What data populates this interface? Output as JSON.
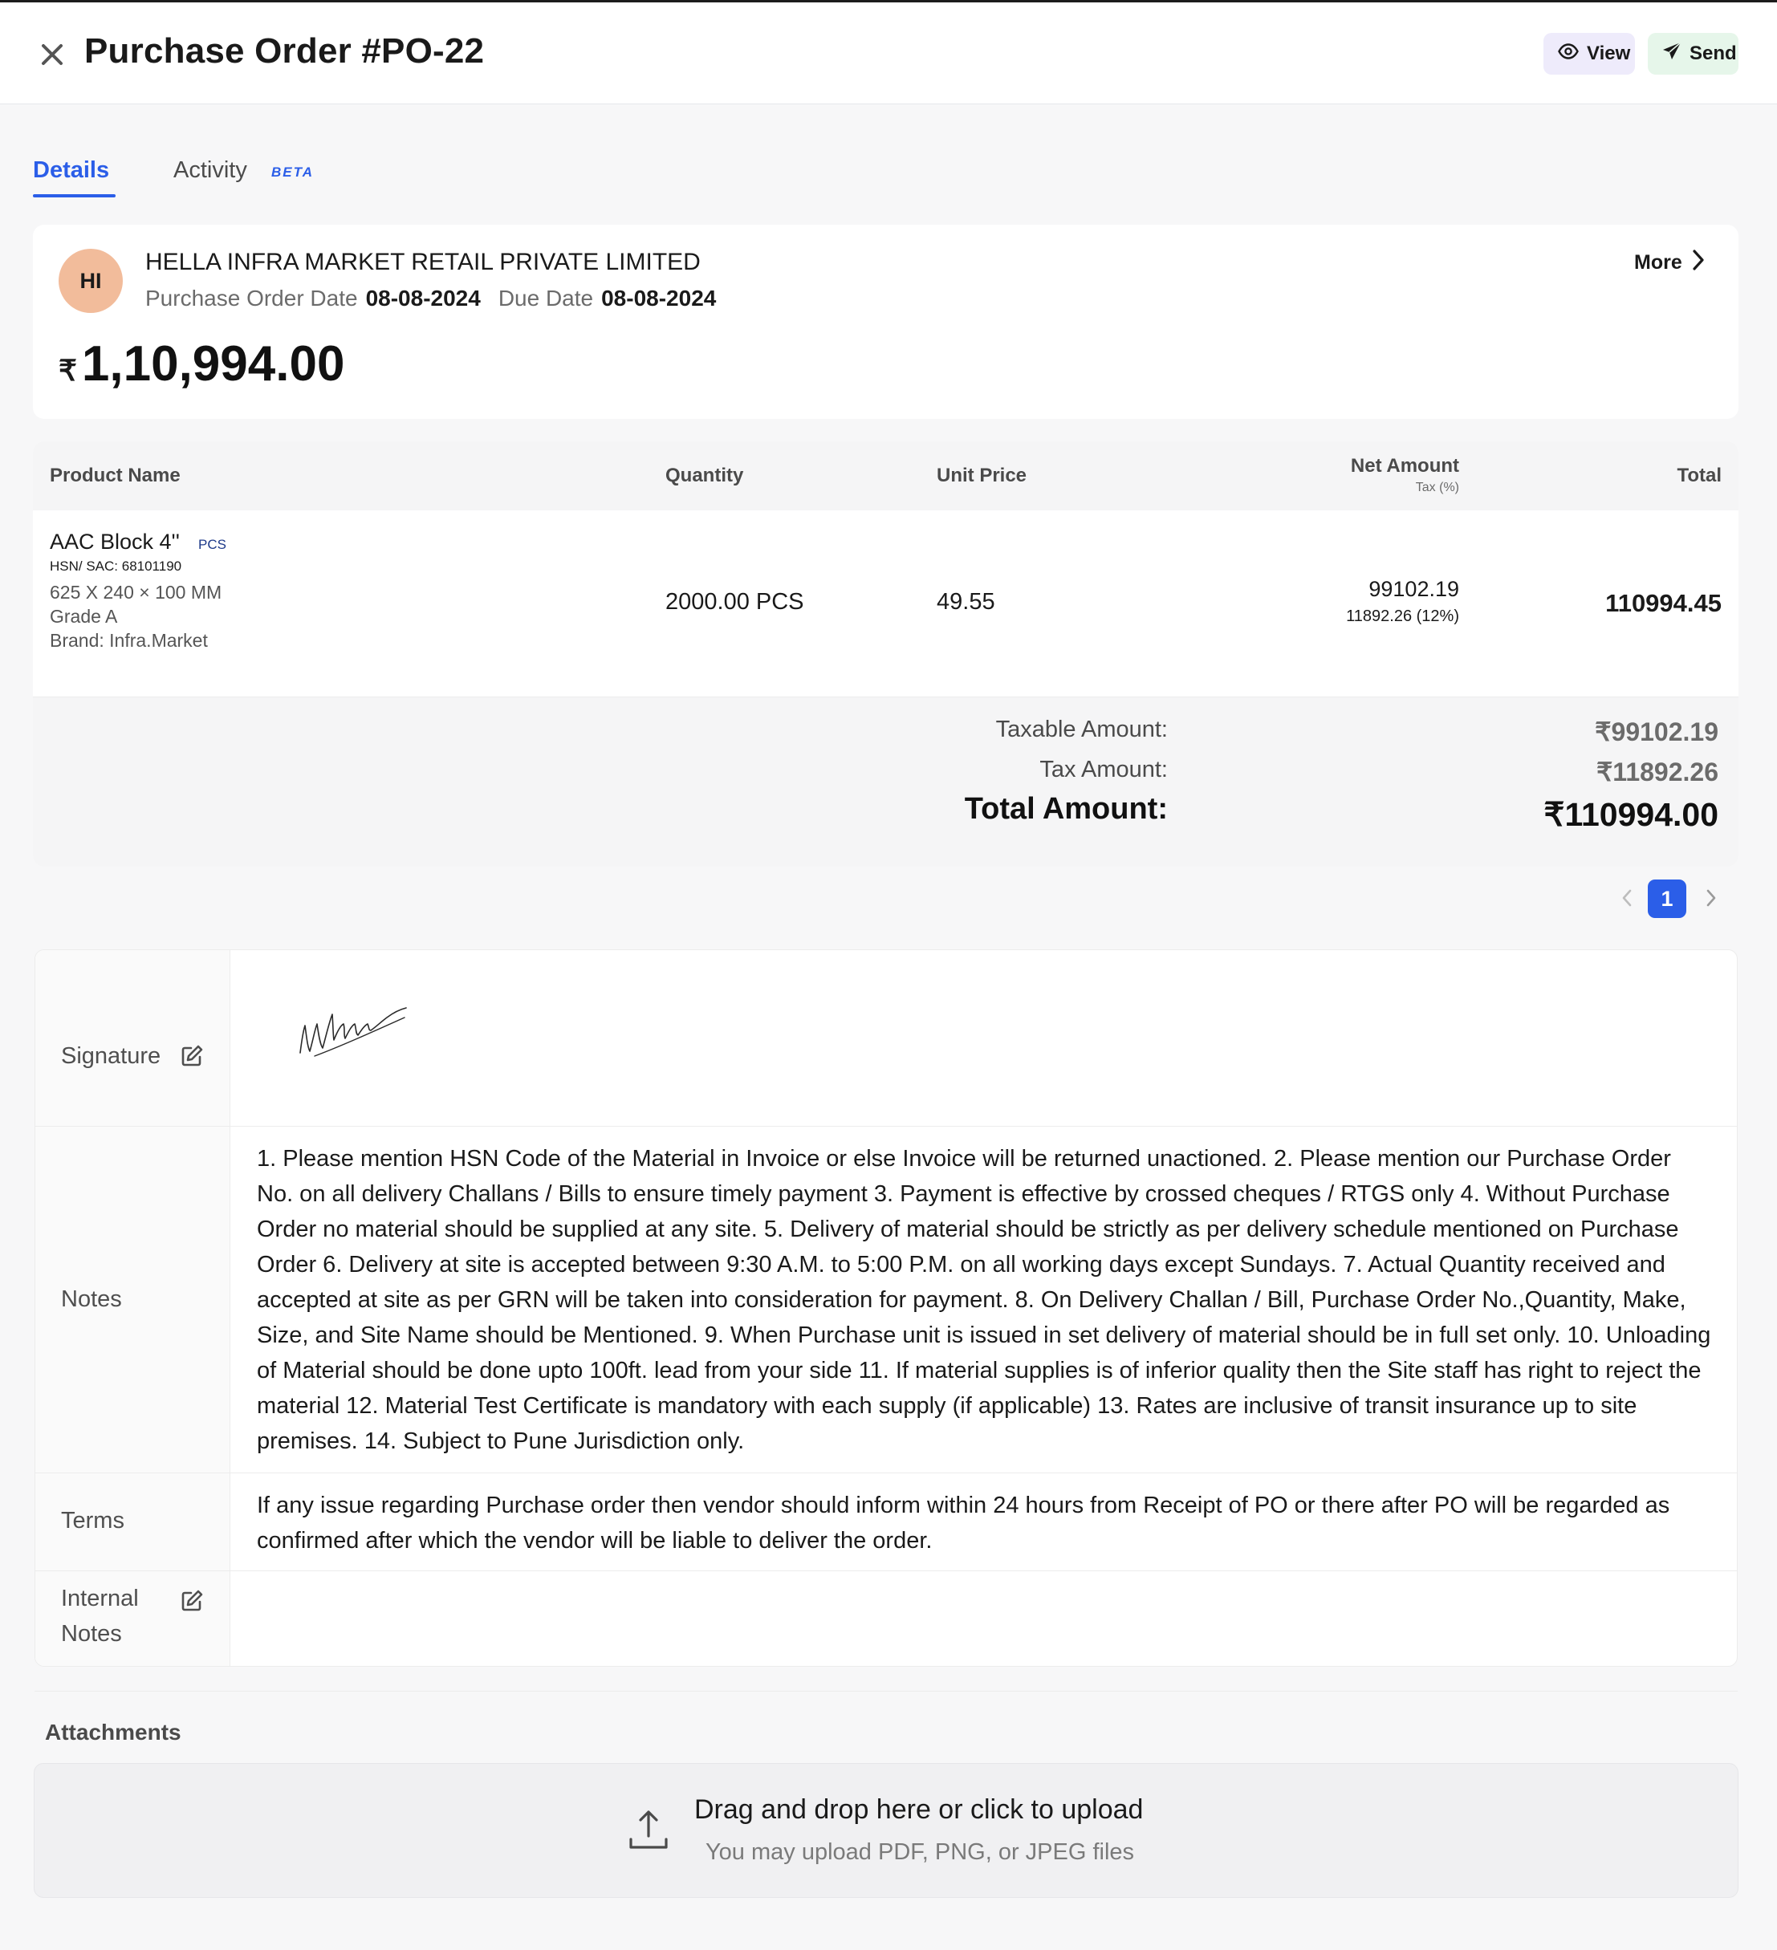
{
  "header": {
    "title": "Purchase Order #PO-22",
    "view_label": "View",
    "send_label": "Send"
  },
  "tabs": [
    {
      "label": "Details",
      "active": true
    },
    {
      "label": "Activity",
      "badge": "BETA",
      "active": false
    }
  ],
  "vendor": {
    "initials": "HI",
    "name": "HELLA INFRA MARKET RETAIL PRIVATE LIMITED",
    "po_date_label": "Purchase Order Date",
    "po_date": "08-08-2024",
    "due_date_label": "Due Date",
    "due_date": "08-08-2024",
    "currency_symbol": "₹",
    "amount": "1,10,994.00",
    "more_label": "More"
  },
  "table": {
    "headers": {
      "product": "Product Name",
      "quantity": "Quantity",
      "unit_price": "Unit Price",
      "net_amount": "Net Amount",
      "net_amount_sub": "Tax (%)",
      "total": "Total"
    },
    "rows": [
      {
        "name": "AAC Block 4''",
        "unit": "PCS",
        "hsn": "HSN/ SAC: 68101190",
        "spec_1": "625 X 240 × 100 MM",
        "spec_2": "Grade A",
        "spec_3": "Brand: Infra.Market",
        "quantity": "2000.00 PCS",
        "unit_price": "49.55",
        "net_amount": "99102.19",
        "tax": "11892.26 (12%)",
        "total": "110994.45"
      }
    ]
  },
  "summary": {
    "taxable_label": "Taxable Amount:",
    "taxable_value": "₹99102.19",
    "tax_label": "Tax Amount:",
    "tax_value": "₹11892.26",
    "total_label": "Total Amount:",
    "total_value": "₹110994.00"
  },
  "pagination": {
    "current_page": "1"
  },
  "details": {
    "signature_label": "Signature",
    "notes_label": "Notes",
    "notes_text": "1. Please mention HSN Code of the Material in Invoice or else Invoice will be returned unactioned. 2. Please mention our Purchase Order No. on all delivery Challans / Bills to ensure timely payment 3. Payment is effective by crossed cheques / RTGS only 4. Without Purchase Order no material should be supplied at any site. 5. Delivery of material should be strictly as per delivery schedule mentioned on Purchase Order 6. Delivery at site is accepted between 9:30 A.M. to 5:00 P.M. on all working days except Sundays. 7. Actual Quantity received and accepted at site as per GRN will be taken into consideration for payment. 8. On Delivery Challan / Bill, Purchase Order No.,Quantity, Make, Size, and Site Name should be Mentioned. 9. When Purchase unit is issued in set delivery of material should be in full set only. 10. Unloading of Material should be done upto 100ft. lead from your side 11. If material supplies is of inferior quality then the Site staff has right to reject the material 12. Material Test Certificate is mandatory with each supply (if applicable) 13. Rates are inclusive of transit insurance up to site premises. 14. Subject to Pune Jurisdiction only.",
    "terms_label": "Terms",
    "terms_text": "If any issue regarding Purchase order then vendor should inform within 24 hours from Receipt of PO or there after PO will be regarded as confirmed after which the vendor will be liable to deliver the order.",
    "internal_notes_label": "Internal Notes",
    "internal_notes_text": ""
  },
  "attachments": {
    "title": "Attachments",
    "drop_text": "Drag and drop here or click to upload",
    "hint_text": "You may upload PDF, PNG, or JPEG files"
  },
  "colors": {
    "accent": "#2b5ee8",
    "avatar_bg": "#f2bc9b",
    "view_bg": "#eeebfb",
    "send_bg": "#e6f6ea",
    "page_bg": "#f7f7f8"
  },
  "icons": {
    "close": "close-icon",
    "view": "eye-icon",
    "send": "paper-plane-icon",
    "more": "chevron-right-icon",
    "edit": "edit-icon",
    "upload": "upload-icon"
  }
}
